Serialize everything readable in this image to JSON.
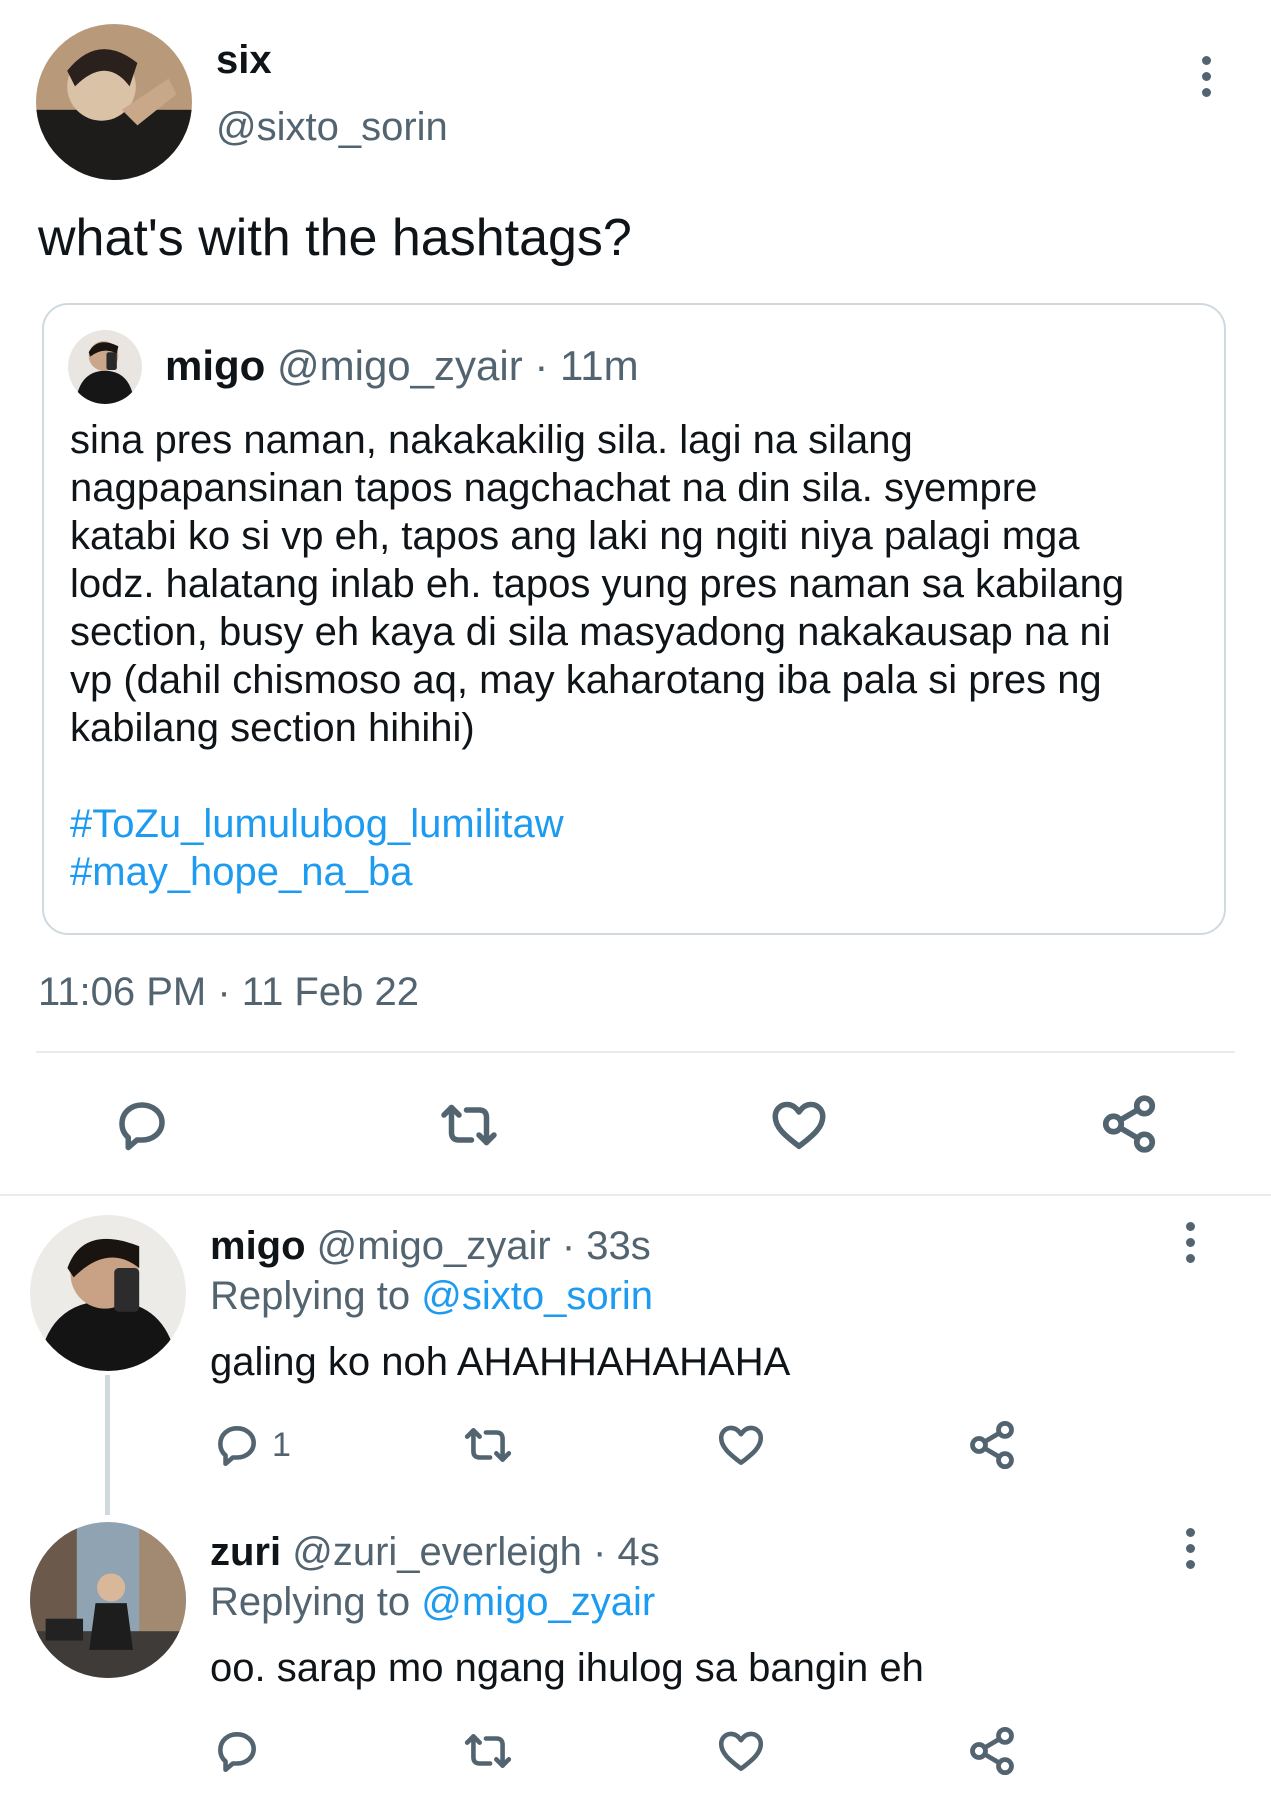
{
  "main_tweet": {
    "name": "six",
    "handle": "@sixto_sorin",
    "text": "what's with the hashtags?",
    "timestamp": "11:06 PM · 11 Feb 22",
    "avatar_icon": "user-avatar"
  },
  "quoted_tweet": {
    "name": "migo",
    "handle": "@migo_zyair",
    "time": "· 11m",
    "lines": [
      "sina pres naman, nakakakilig sila. lagi na silang",
      "nagpapansinan tapos nagchachat na din sila. syempre",
      "katabi ko si vp eh, tapos ang laki ng ngiti niya palagi mga",
      "lodz. halatang inlab eh. tapos yung pres naman sa kabilang",
      "section, busy eh kaya di sila masyadong nakakausap na ni",
      "vp (dahil chismoso aq, may kaharotang iba pala si pres ng",
      "kabilang section hihihi)"
    ],
    "hashtags": [
      "#ToZu_lumulubog_lumilitaw",
      "#may_hope_na_ba"
    ]
  },
  "actions": {
    "icons": [
      "reply-icon",
      "retweet-icon",
      "like-icon",
      "share-icon"
    ]
  },
  "replies": [
    {
      "name": "migo",
      "handle": "@migo_zyair",
      "time": "· 33s",
      "replying_label": "Replying to",
      "replying_to": "@sixto_sorin",
      "text": "galing ko noh AHAHHAHAHAHA",
      "reply_count": "1"
    },
    {
      "name": "zuri",
      "handle": "@zuri_everleigh",
      "time": "· 4s",
      "replying_label": "Replying to",
      "replying_to": "@migo_zyair",
      "text": "oo. sarap mo ngang ihulog sa bangin eh",
      "reply_count": ""
    }
  ],
  "colors": {
    "link": "#1d9bf0",
    "muted": "#536471",
    "border": "#cfd9de"
  }
}
